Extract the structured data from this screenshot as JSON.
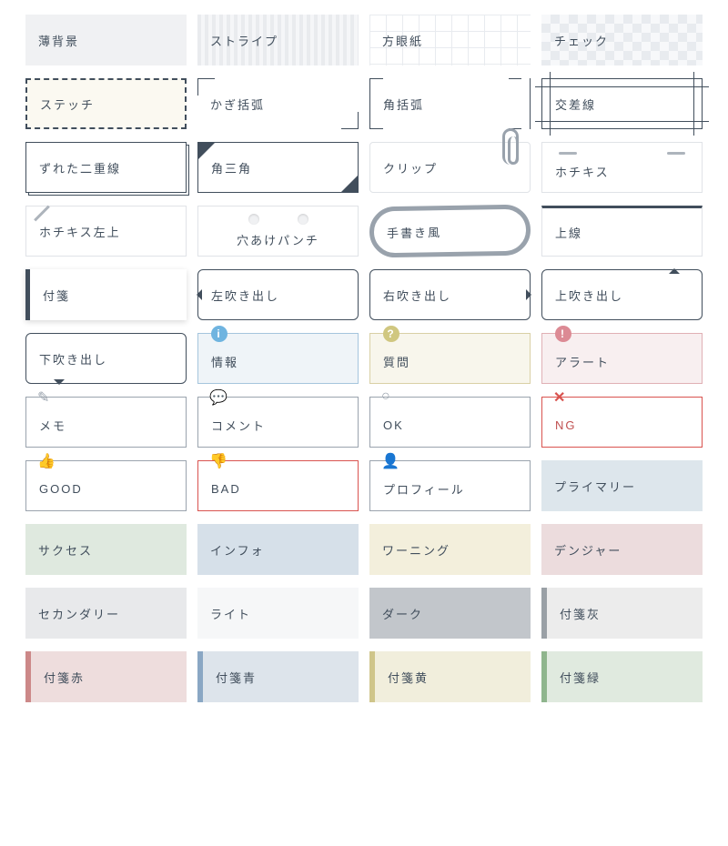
{
  "styles": [
    {
      "label": "薄背景"
    },
    {
      "label": "ストライプ"
    },
    {
      "label": "方眼紙"
    },
    {
      "label": "チェック"
    },
    {
      "label": "ステッチ"
    },
    {
      "label": "かぎ括弧"
    },
    {
      "label": "角括弧"
    },
    {
      "label": "交差線"
    },
    {
      "label": "ずれた二重線"
    },
    {
      "label": "角三角"
    },
    {
      "label": "クリップ"
    },
    {
      "label": "ホチキス"
    },
    {
      "label": "ホチキス左上"
    },
    {
      "label": "穴あけパンチ"
    },
    {
      "label": "手書き風"
    },
    {
      "label": "上線"
    },
    {
      "label": "付箋"
    },
    {
      "label": "左吹き出し"
    },
    {
      "label": "右吹き出し"
    },
    {
      "label": "上吹き出し"
    },
    {
      "label": "下吹き出し"
    },
    {
      "label": "情報"
    },
    {
      "label": "質問"
    },
    {
      "label": "アラート"
    },
    {
      "label": "メモ"
    },
    {
      "label": "コメント"
    },
    {
      "label": "OK"
    },
    {
      "label": "NG"
    },
    {
      "label": "GOOD"
    },
    {
      "label": "BAD"
    },
    {
      "label": "プロフィール"
    },
    {
      "label": "プライマリー"
    },
    {
      "label": "サクセス"
    },
    {
      "label": "インフォ"
    },
    {
      "label": "ワーニング"
    },
    {
      "label": "デンジャー"
    },
    {
      "label": "セカンダリー"
    },
    {
      "label": "ライト"
    },
    {
      "label": "ダーク"
    },
    {
      "label": "付箋灰"
    },
    {
      "label": "付箋赤"
    },
    {
      "label": "付箋青"
    },
    {
      "label": "付箋黄"
    },
    {
      "label": "付箋緑"
    }
  ],
  "icons": {
    "info": "i",
    "question": "?",
    "alert": "!",
    "pencil": "✎",
    "comment": "💬",
    "ok": "○",
    "ng": "✕",
    "good": "👍",
    "bad": "👎",
    "profile": "👤"
  }
}
